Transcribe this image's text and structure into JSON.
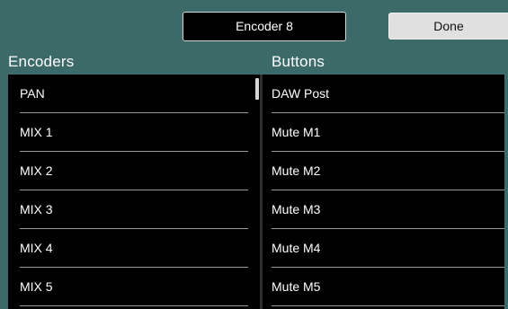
{
  "header": {
    "encoder_button_label": "Encoder 8",
    "done_button_label": "Done"
  },
  "columns": {
    "encoders_title": "Encoders",
    "buttons_title": "Buttons"
  },
  "encoders": [
    "PAN",
    "MIX 1",
    "MIX 2",
    "MIX 3",
    "MIX 4",
    "MIX 5"
  ],
  "buttons": [
    "DAW Post",
    "Mute M1",
    "Mute M2",
    "Mute M3",
    "Mute M4",
    "Mute M5"
  ]
}
